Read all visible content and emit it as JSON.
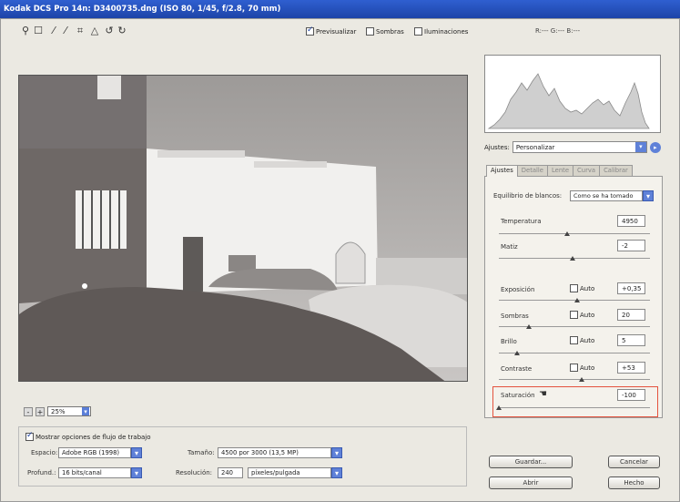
{
  "window": {
    "title": "Kodak DCS Pro 14n: D3400735.dng  (ISO 80, 1/45, f/2.8, 70 mm)"
  },
  "toolbar": {
    "tools": [
      "zoom-icon",
      "hand-icon",
      "eyedropper-icon",
      "color-sampler-icon",
      "crop-icon",
      "straighten-icon",
      "rotate-left-icon",
      "rotate-right-icon"
    ],
    "preview_label": "Previsualizar",
    "preview_checked": true,
    "shadows_label": "Sombras",
    "highlights_label": "Iluminaciones",
    "rgb_readout": "R:---  G:---  B:---"
  },
  "zoom": {
    "value": "25%"
  },
  "workflow": {
    "show_label": "Mostrar opciones de flujo de trabajo",
    "space_label": "Espacio:",
    "space_value": "Adobe RGB (1998)",
    "depth_label": "Profund.:",
    "depth_value": "16 bits/canal",
    "size_label": "Tamaño:",
    "size_value": "4500 por 3000  (13,5 MP)",
    "resolution_label": "Resolución:",
    "resolution_value": "240",
    "resolution_unit": "píxeles/pulgada"
  },
  "settings": {
    "label": "Ajustes:",
    "value": "Personalizar"
  },
  "tabs": [
    "Ajustes",
    "Detalle",
    "Lente",
    "Curva",
    "Calibrar"
  ],
  "panel": {
    "white_balance_label": "Equilibrio de blancos:",
    "white_balance_value": "Como se ha tomado",
    "auto_label": "Auto",
    "params": {
      "temperatura": {
        "label": "Temperatura",
        "value": "4950",
        "level": 0.45
      },
      "matiz": {
        "label": "Matiz",
        "value": "-2",
        "level": 0.49
      },
      "exposicion": {
        "label": "Exposición",
        "value": "+0,35",
        "level": 0.52
      },
      "sombras": {
        "label": "Sombras",
        "value": "20",
        "level": 0.2
      },
      "brillo": {
        "label": "Brillo",
        "value": "5",
        "level": 0.12
      },
      "contraste": {
        "label": "Contraste",
        "value": "+53",
        "level": 0.55
      },
      "saturacion": {
        "label": "Saturación",
        "value": "-100",
        "level": 0.0
      }
    }
  },
  "buttons": {
    "save": "Guardar...",
    "open": "Abrir",
    "cancel": "Cancelar",
    "done": "Hecho"
  },
  "colors": {
    "title_bar": "#2f5fd0",
    "highlight_box": "#e4533e",
    "dropdown_button": "#5f81d8"
  }
}
